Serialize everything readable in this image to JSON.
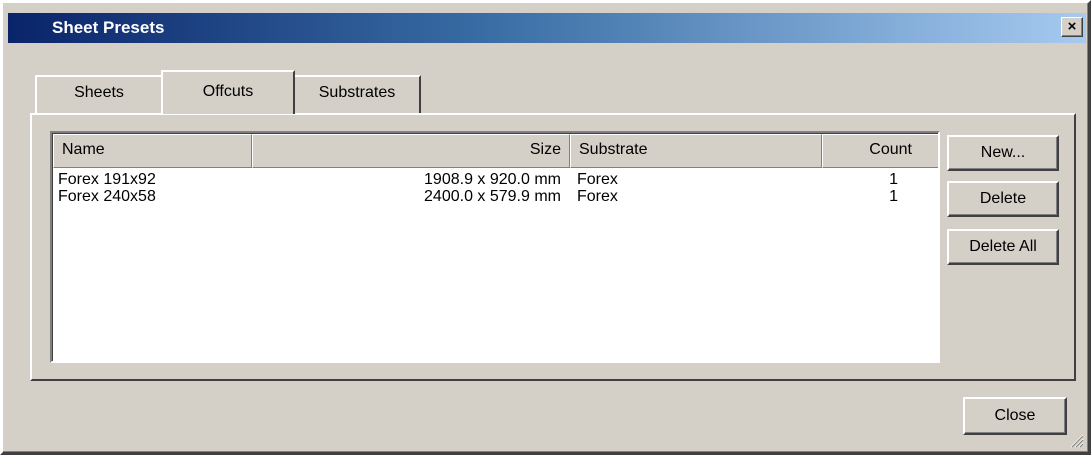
{
  "window": {
    "title": "Sheet Presets",
    "close_glyph": "×",
    "icon": "close-icon"
  },
  "tabs": [
    {
      "label": "Sheets",
      "selected": false
    },
    {
      "label": "Offcuts",
      "selected": true
    },
    {
      "label": "Substrates",
      "selected": false
    }
  ],
  "list": {
    "columns": [
      "Name",
      "Size",
      "Substrate",
      "Count"
    ],
    "rows": [
      {
        "name": "Forex 191x92",
        "size": "1908.9 x 920.0 mm",
        "substrate": "Forex",
        "count": "1"
      },
      {
        "name": "Forex 240x58",
        "size": "2400.0 x 579.9 mm",
        "substrate": "Forex",
        "count": "1"
      }
    ]
  },
  "buttons": {
    "new": "New...",
    "delete": "Delete",
    "delete_all": "Delete All",
    "close": "Close"
  },
  "colors": {
    "dialog_face": "#d4d0c8",
    "title_gradient_start": "#0a246a",
    "title_gradient_end": "#a6caf0",
    "title_text": "#ffffff"
  }
}
